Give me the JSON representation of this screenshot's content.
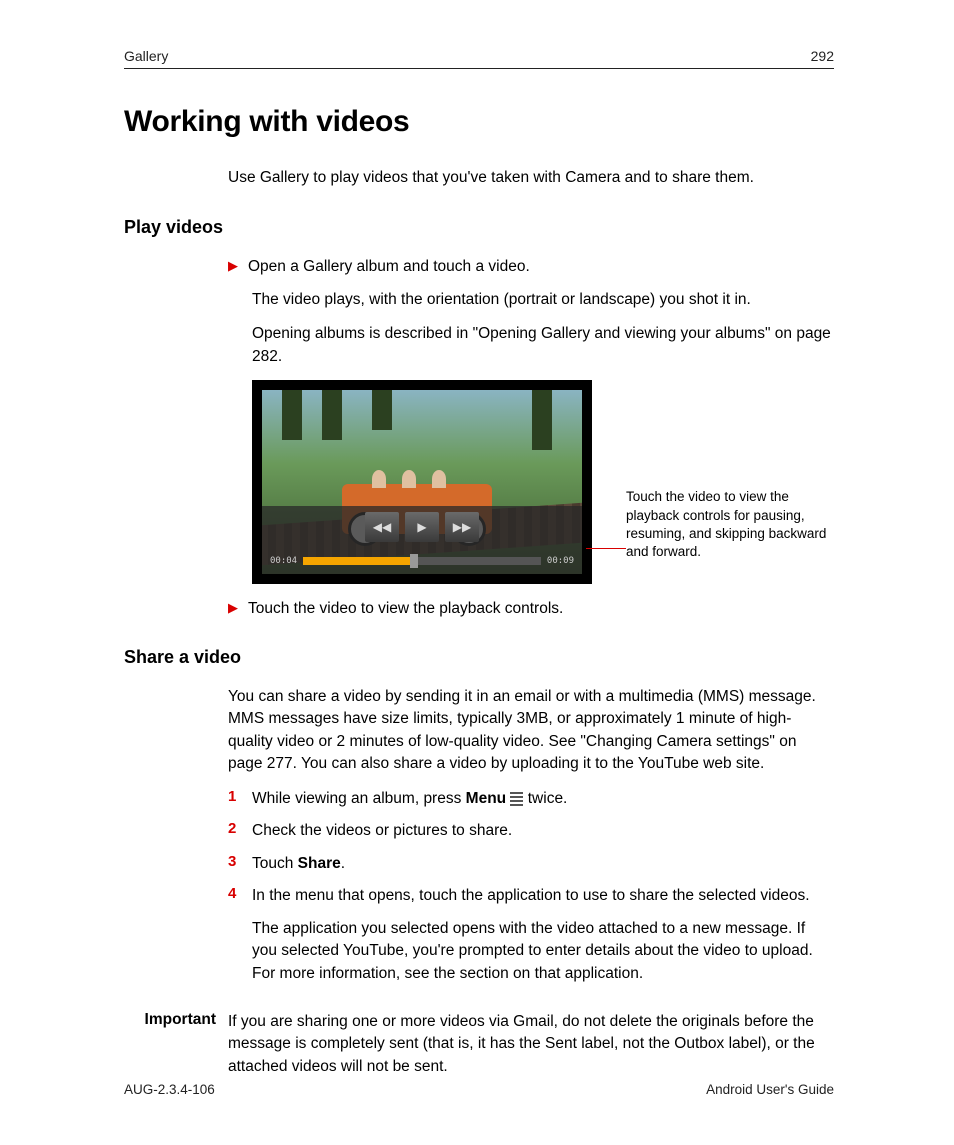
{
  "header": {
    "section": "Gallery",
    "page_number": "292"
  },
  "title": "Working with videos",
  "intro": "Use Gallery to play videos that you've taken with Camera and to share them.",
  "play_videos": {
    "heading": "Play videos",
    "bullet1": "Open a Gallery album and touch a video.",
    "line1": "The video plays, with the orientation (portrait or landscape) you shot it in.",
    "line2": "Opening albums is described in \"Opening Gallery and viewing your albums\" on page 282.",
    "callout": "Touch the video to view the playback controls for pausing, resuming, and skipping backward and forward.",
    "bullet2": "Touch the video to view the playback controls.",
    "player": {
      "elapsed": "00:04",
      "total": "00:09"
    }
  },
  "share_video": {
    "heading": "Share a video",
    "intro": "You can share a video by sending it in an email or with a multimedia (MMS) message. MMS messages have size limits, typically 3MB, or approximately 1 minute of high-quality video or 2 minutes of low-quality video. See \"Changing Camera settings\" on page 277. You can also share a video by uploading it to the YouTube web site.",
    "steps": {
      "s1a": "While viewing an album, press ",
      "s1b": "Menu",
      "s1c": " twice.",
      "s2": "Check the videos or pictures to share.",
      "s3a": "Touch ",
      "s3b": "Share",
      "s3c": ".",
      "s4": "In the menu that opens, touch the application to use to share the selected videos."
    },
    "result": "The application you selected opens with the video attached to a new message. If you selected YouTube, you're prompted to enter details about the video to upload. For more information, see the section on that application.",
    "important_label": "Important",
    "important_text": "If you are sharing one or more videos via Gmail, do not delete the originals before the message is completely sent (that is, it has the Sent label, not the Outbox label), or the attached videos will not be sent."
  },
  "footer": {
    "doc_id": "AUG-2.3.4-106",
    "doc_title": "Android User's Guide"
  },
  "nums": {
    "n1": "1",
    "n2": "2",
    "n3": "3",
    "n4": "4"
  }
}
